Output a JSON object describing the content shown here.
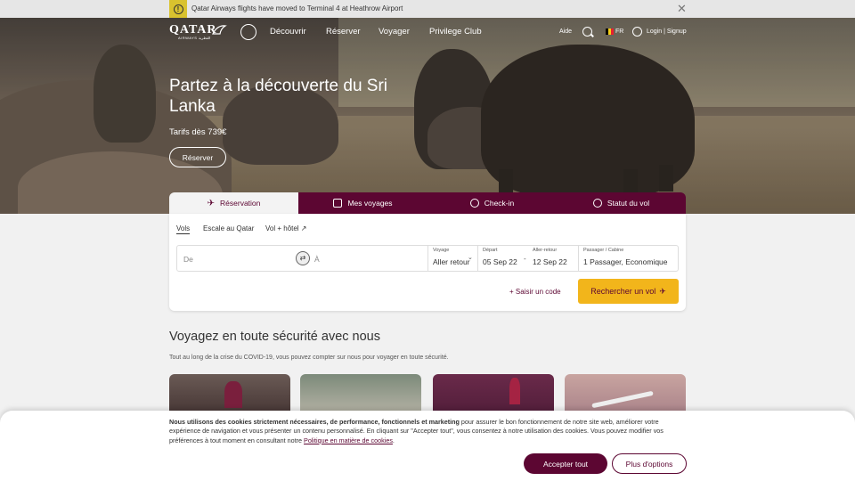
{
  "alert": {
    "icon": "alert-circle-icon",
    "text": "Qatar Airways flights have moved to Terminal 4 at Heathrow Airport",
    "close": "✕"
  },
  "nav": {
    "logo": "QATAR",
    "logo_sub": "AIRWAYS القطرية",
    "links": [
      "Découvrir",
      "Réserver",
      "Voyager",
      "Privilege Club"
    ],
    "help": "Aide",
    "language": "FR",
    "login": "Login | Signup"
  },
  "hero": {
    "title": "Partez à la découverte du Sri Lanka",
    "price": "Tarifs dès 739€",
    "cta": "Réserver"
  },
  "booking": {
    "tabs": [
      "Réservation",
      "Mes voyages",
      "Check-in",
      "Statut du vol"
    ],
    "subtabs": [
      "Vols",
      "Escale au Qatar",
      "Vol + hôtel ↗"
    ],
    "from_placeholder": "De",
    "to_placeholder": "À",
    "trip_label": "Voyage",
    "trip_value": "Aller retour",
    "depart_label": "Départ",
    "depart_value": "05 Sep 22",
    "return_label": "Aller-retour",
    "return_value": "12 Sep 22",
    "pax_label": "Passager / Cabine",
    "pax_value": "1 Passager, Economique",
    "promo": "+ Saisir un code",
    "search": "Rechercher un vol"
  },
  "safety": {
    "title": "Voyagez en toute sécurité avec nous",
    "subtitle": "Tout au long de la crise du COVID-19, vous pouvez compter sur nous pour voyager en toute sécurité."
  },
  "cookie": {
    "bold": "Nous utilisons des cookies strictement nécessaires, de performance, fonctionnels et marketing",
    "text": " pour assurer le bon fonctionnement de notre site web, améliorer votre expérience de navigation et vous présenter un contenu personnalisé. En cliquant sur \"Accepter tout\", vous consentez à notre utilisation des cookies. Vous pouvez modifier vos préférences à tout moment en consultant notre ",
    "link": "Politique en matière de cookies",
    "end": ".",
    "accept": "Accepter tout",
    "more": "Plus d'options"
  },
  "colors": {
    "brand": "#5c0632",
    "accent": "#f2b51b"
  }
}
